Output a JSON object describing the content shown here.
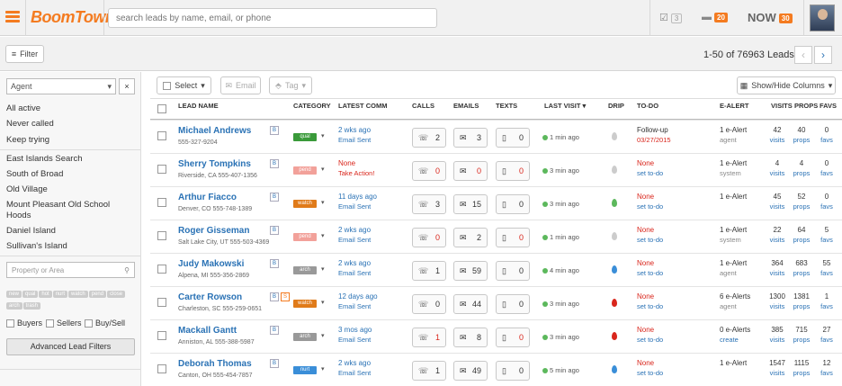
{
  "header": {
    "logo": "BoomTown!",
    "search_placeholder": "search leads by name, email, or phone",
    "tasks_count": "3",
    "messages_count": "20",
    "now_label": "NOW",
    "now_count": "30"
  },
  "toolbar": {
    "filter": "Filter",
    "lead_count": "1-50 of 76963 Leads",
    "select": "Select",
    "email": "Email",
    "tag": "Tag",
    "show_hide": "Show/Hide Columns"
  },
  "sidebar": {
    "agent": "Agent",
    "links": [
      "All active",
      "Never called",
      "Keep trying"
    ],
    "searches": [
      "East Islands Search",
      "South of Broad",
      "Old Village",
      "Mount Pleasant Old School Hoods",
      "Daniel Island",
      "Sullivan's Island"
    ],
    "property_placeholder": "Property or Area",
    "tags": [
      "new",
      "qual",
      "hot",
      "nurt",
      "watch",
      "pend",
      "close",
      "arch",
      "trash"
    ],
    "checks": [
      "Buyers",
      "Sellers",
      "Buy/Sell"
    ],
    "advanced": "Advanced Lead Filters"
  },
  "columns": [
    "LEAD NAME",
    "CATEGORY",
    "LATEST COMM",
    "CALLS",
    "EMAILS",
    "TEXTS",
    "LAST VISIT",
    "DRIP",
    "TO-DO",
    "E-ALERT",
    "VISITS",
    "PROPS",
    "FAVS"
  ],
  "colors": {
    "accent": "#f47b20",
    "link": "#2a72b5",
    "red": "#d9261c",
    "green": "#5cb85c"
  },
  "leads": [
    {
      "name": "Michael Andrews",
      "loc": "",
      "phone": "555-327-9204",
      "badges": [
        "B"
      ],
      "cat": "qual",
      "catcolor": "#3a9a3a",
      "comm1": "2 wks ago",
      "comm2": "Email Sent",
      "commred": false,
      "calls": "2",
      "emails": "3",
      "texts": "0",
      "callsred": false,
      "emailsred": false,
      "textsred": false,
      "visit": "1 min ago",
      "dripcolor": "#ccc",
      "todo1": "Follow-up",
      "todo2": "03/27/2015",
      "todored": false,
      "ea1": "1 e-Alert",
      "ea2": "agent",
      "visits": "42",
      "props": "40",
      "favs": "0"
    },
    {
      "name": "Sherry Tompkins",
      "loc": "Riverside, CA",
      "phone": "555-407-1356",
      "badges": [
        "B"
      ],
      "cat": "pend",
      "catcolor": "#f2a19a",
      "comm1": "None",
      "comm2": "Take Action!",
      "commred": true,
      "calls": "0",
      "emails": "0",
      "texts": "0",
      "callsred": true,
      "emailsred": true,
      "textsred": true,
      "visit": "3 min ago",
      "dripcolor": "#ccc",
      "todo1": "None",
      "todo2": "set to-do",
      "todored": true,
      "ea1": "1 e-Alert",
      "ea2": "system",
      "visits": "4",
      "props": "4",
      "favs": "0"
    },
    {
      "name": "Arthur Fiacco",
      "loc": "Denver, CO",
      "phone": "555-748-1389",
      "badges": [
        "B"
      ],
      "cat": "watch",
      "catcolor": "#e07b1a",
      "comm1": "11 days ago",
      "comm2": "Email Sent",
      "commred": false,
      "calls": "3",
      "emails": "15",
      "texts": "0",
      "callsred": false,
      "emailsred": false,
      "textsred": false,
      "visit": "3 min ago",
      "dripcolor": "#5cb85c",
      "todo1": "None",
      "todo2": "set to-do",
      "todored": true,
      "ea1": "1 e-Alert",
      "ea2": "",
      "visits": "45",
      "props": "52",
      "favs": "0"
    },
    {
      "name": "Roger Gisseman",
      "loc": "Salt Lake City, UT",
      "phone": "555-503-4369",
      "badges": [
        "B"
      ],
      "cat": "pend",
      "catcolor": "#f2a19a",
      "comm1": "2 wks ago",
      "comm2": "Email Sent",
      "commred": false,
      "calls": "0",
      "emails": "2",
      "texts": "0",
      "callsred": true,
      "emailsred": false,
      "textsred": true,
      "visit": "1 min ago",
      "dripcolor": "#ccc",
      "todo1": "None",
      "todo2": "set to-do",
      "todored": true,
      "ea1": "1 e-Alert",
      "ea2": "system",
      "visits": "22",
      "props": "64",
      "favs": "5"
    },
    {
      "name": "Judy Makowski",
      "loc": "Alpena, MI",
      "phone": "555-356-2869",
      "badges": [
        "B"
      ],
      "cat": "arch",
      "catcolor": "#999",
      "comm1": "2 wks ago",
      "comm2": "Email Sent",
      "commred": false,
      "calls": "1",
      "emails": "59",
      "texts": "0",
      "callsred": false,
      "emailsred": false,
      "textsred": false,
      "visit": "4 min ago",
      "dripcolor": "#3a8ed8",
      "todo1": "None",
      "todo2": "set to-do",
      "todored": true,
      "ea1": "1 e-Alert",
      "ea2": "agent",
      "visits": "364",
      "props": "683",
      "favs": "55"
    },
    {
      "name": "Carter Rowson",
      "loc": "Charleston, SC",
      "phone": "555-259-0651",
      "badges": [
        "B",
        "S"
      ],
      "cat": "watch",
      "catcolor": "#e07b1a",
      "comm1": "12 days ago",
      "comm2": "Email Sent",
      "commred": false,
      "calls": "0",
      "emails": "44",
      "texts": "0",
      "callsred": false,
      "emailsred": false,
      "textsred": false,
      "visit": "3 min ago",
      "dripcolor": "#d9261c",
      "todo1": "None",
      "todo2": "set to-do",
      "todored": true,
      "ea1": "6 e-Alerts",
      "ea2": "agent",
      "visits": "1300",
      "props": "1381",
      "favs": "1"
    },
    {
      "name": "Mackall Gantt",
      "loc": "Anniston, AL",
      "phone": "555-388-5987",
      "badges": [
        "B"
      ],
      "cat": "arch",
      "catcolor": "#999",
      "comm1": "3 mos ago",
      "comm2": "Email Sent",
      "commred": false,
      "calls": "1",
      "emails": "8",
      "texts": "0",
      "callsred": true,
      "emailsred": false,
      "textsred": true,
      "visit": "3 min ago",
      "dripcolor": "#d9261c",
      "todo1": "None",
      "todo2": "set to-do",
      "todored": true,
      "ea1": "0 e-Alerts",
      "ea2": "create",
      "visits": "385",
      "props": "715",
      "favs": "27"
    },
    {
      "name": "Deborah Thomas",
      "loc": "Canton, OH",
      "phone": "555-454-7857",
      "badges": [
        "B"
      ],
      "cat": "nurt",
      "catcolor": "#3a8ed8",
      "comm1": "2 wks ago",
      "comm2": "Email Sent",
      "commred": false,
      "calls": "1",
      "emails": "49",
      "texts": "0",
      "callsred": false,
      "emailsred": false,
      "textsred": false,
      "visit": "5 min ago",
      "dripcolor": "#3a8ed8",
      "todo1": "None",
      "todo2": "set to-do",
      "todored": true,
      "ea1": "1 e-Alert",
      "ea2": "",
      "visits": "1547",
      "props": "1115",
      "favs": "12"
    }
  ]
}
